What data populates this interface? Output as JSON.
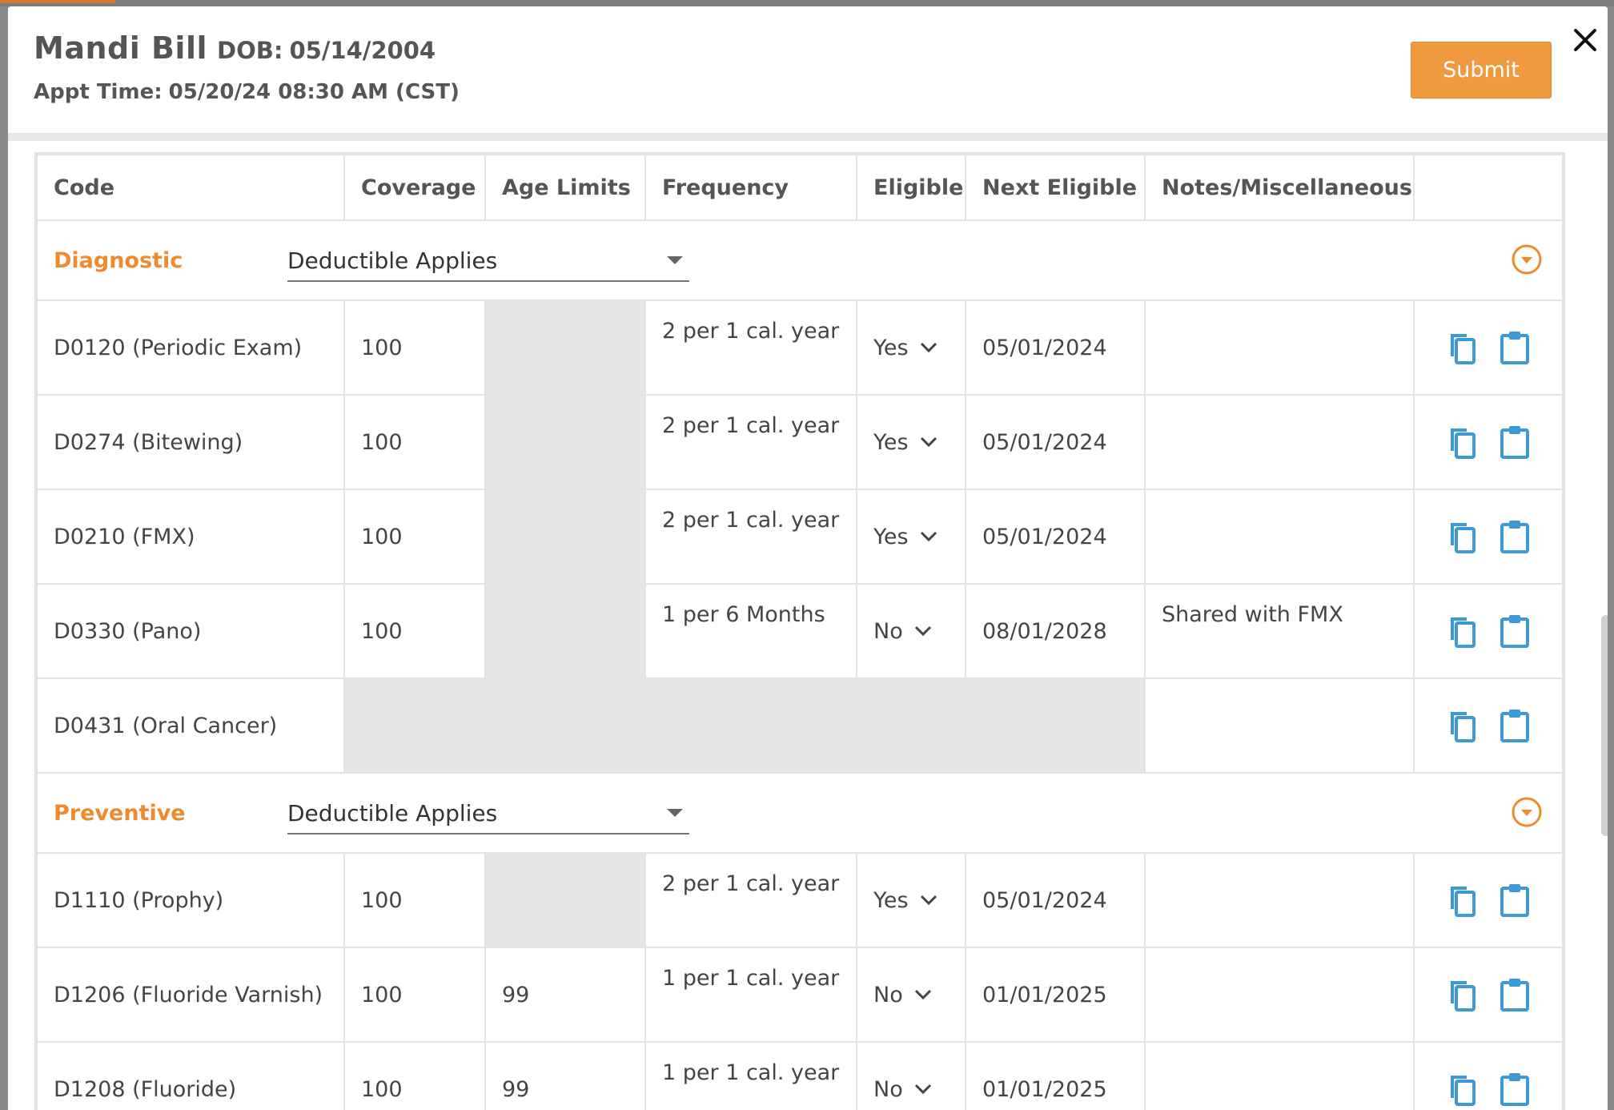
{
  "header": {
    "patient_name": "Mandi Bill",
    "dob_label": "DOB:",
    "dob": "05/14/2004",
    "appt_label": "Appt Time:",
    "appt_time": "05/20/24 08:30 AM (CST)",
    "submit_label": "Submit"
  },
  "table": {
    "columns": [
      "Code",
      "Coverage",
      "Age Limits",
      "Frequency",
      "Eligible",
      "Next Eligible",
      "Notes/Miscellaneous",
      ""
    ],
    "categories": [
      {
        "name": "Diagnostic",
        "deductible": "Deductible Applies",
        "rows": [
          {
            "code": "D0120 (Periodic Exam)",
            "coverage": "100",
            "age": "",
            "frequency": "2 per 1 cal. year",
            "eligible": "Yes",
            "next": "05/01/2024",
            "notes": ""
          },
          {
            "code": "D0274 (Bitewing)",
            "coverage": "100",
            "age": "",
            "frequency": "2 per 1 cal. year",
            "eligible": "Yes",
            "next": "05/01/2024",
            "notes": ""
          },
          {
            "code": "D0210 (FMX)",
            "coverage": "100",
            "age": "",
            "frequency": "2 per 1 cal. year",
            "eligible": "Yes",
            "next": "05/01/2024",
            "notes": ""
          },
          {
            "code": "D0330 (Pano)",
            "coverage": "100",
            "age": "",
            "frequency": "1 per 6 Months",
            "eligible": "No",
            "next": "08/01/2028",
            "notes": "Shared with FMX"
          },
          {
            "code": "D0431 (Oral Cancer)",
            "coverage": "",
            "age": "",
            "frequency": "",
            "eligible": "",
            "next": "",
            "notes": ""
          }
        ]
      },
      {
        "name": "Preventive",
        "deductible": "Deductible Applies",
        "rows": [
          {
            "code": "D1110 (Prophy)",
            "coverage": "100",
            "age": "",
            "frequency": "2 per 1 cal. year",
            "eligible": "Yes",
            "next": "05/01/2024",
            "notes": ""
          },
          {
            "code": "D1206 (Fluoride Varnish)",
            "coverage": "100",
            "age": "99",
            "frequency": "1 per 1 cal. year",
            "eligible": "No",
            "next": "01/01/2025",
            "notes": ""
          },
          {
            "code": "D1208 (Fluoride)",
            "coverage": "100",
            "age": "99",
            "frequency": "1 per 1 cal. year",
            "eligible": "No",
            "next": "01/01/2025",
            "notes": ""
          }
        ]
      }
    ]
  },
  "colors": {
    "accent_orange": "#ef8a2e",
    "submit_orange": "#ef9a3f",
    "icon_blue": "#3d9ad6",
    "grey_cell": "#e5e5e5"
  },
  "icons": {
    "close": "close-icon",
    "copy": "copy-icon",
    "paste": "clipboard-icon",
    "collapse": "chevron-down-circle-icon"
  }
}
